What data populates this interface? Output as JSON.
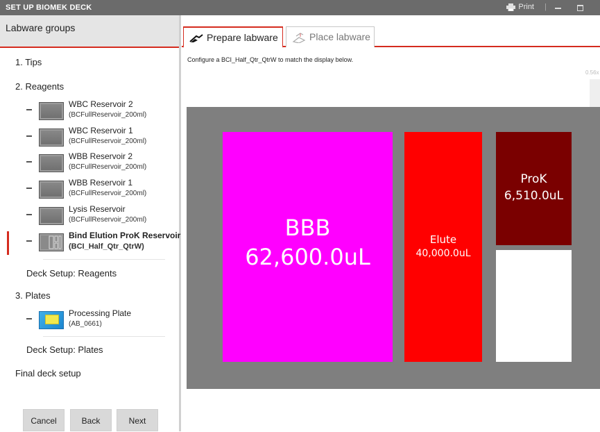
{
  "window": {
    "title": "SET UP BIOMEK DECK",
    "print_label": "Print",
    "separator": "|"
  },
  "sidebar": {
    "header": "Labware groups",
    "sections": {
      "tips": "1. Tips",
      "reagents": "2. Reagents",
      "plates": "3. Plates"
    },
    "reagents": [
      {
        "name": "WBC Reservoir 2",
        "type": "(BCFullReservoir_200ml)"
      },
      {
        "name": "WBC Reservoir 1",
        "type": "(BCFullReservoir_200ml)"
      },
      {
        "name": "WBB Reservoir 2",
        "type": "(BCFullReservoir_200ml)"
      },
      {
        "name": "WBB Reservoir 1",
        "type": "(BCFullReservoir_200ml)"
      },
      {
        "name": "Lysis Reservoir",
        "type": "(BCFullReservoir_200ml)"
      },
      {
        "name": "Bind Elution ProK Reservoir",
        "type": "(BCI_Half_Qtr_QtrW)"
      }
    ],
    "deck_setup_reagents": "Deck Setup: Reagents",
    "plates": [
      {
        "name": "Processing Plate",
        "type": "(AB_0661)"
      }
    ],
    "deck_setup_plates": "Deck Setup: Plates",
    "final": "Final deck setup"
  },
  "buttons": {
    "cancel": "Cancel",
    "back": "Back",
    "next": "Next"
  },
  "tabs": [
    {
      "label": "Prepare labware",
      "selected": true
    },
    {
      "label": "Place labware",
      "selected": false
    }
  ],
  "instruction": "Configure a BCI_Half_Qtr_QtrW to match the display below.",
  "zoom_label": "0.56x",
  "wells": [
    {
      "name": "BBB",
      "volume": "62,600.0uL",
      "color": "#ff00ff"
    },
    {
      "name": "Elute",
      "volume": "40,000.0uL",
      "color": "#ff0000"
    },
    {
      "name": "ProK",
      "volume": "6,510.0uL",
      "color": "#7a0000"
    },
    {
      "name": "",
      "volume": "",
      "color": "#ffffff"
    }
  ],
  "colors": {
    "accent": "#d52b1e",
    "deck": "#7f7f7f"
  }
}
